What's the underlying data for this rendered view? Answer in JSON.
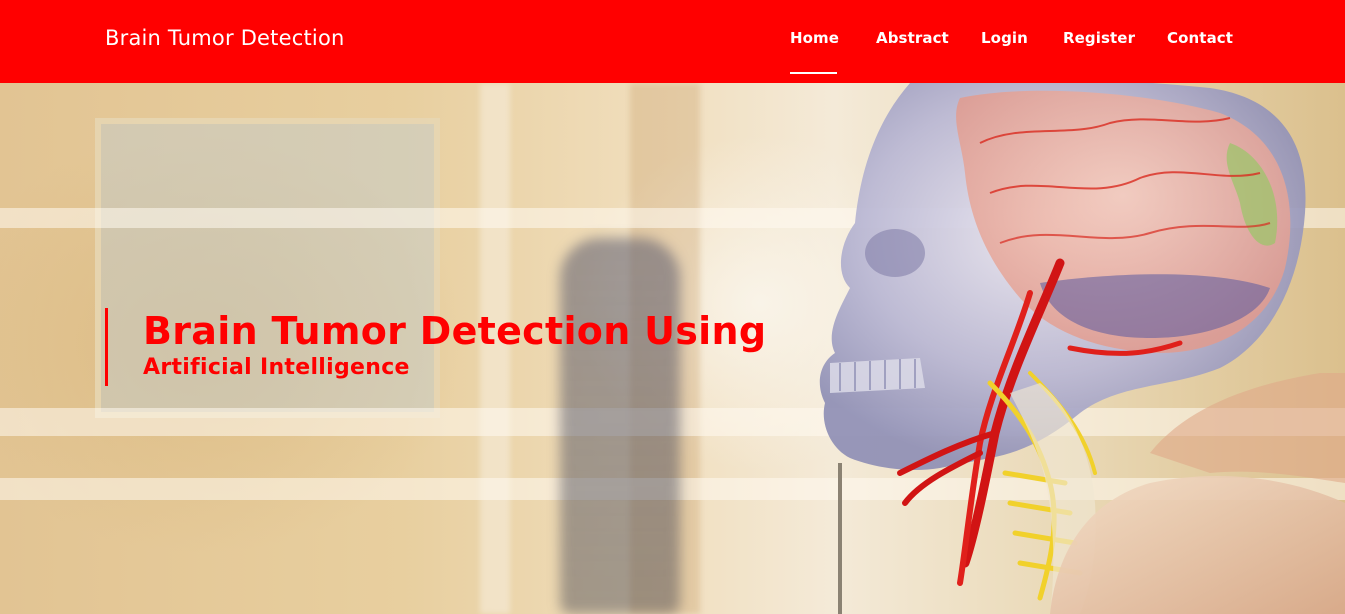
{
  "header": {
    "brand": "Brain Tumor Detection",
    "nav": [
      {
        "label": "Home",
        "active": true
      },
      {
        "label": "Abstract",
        "active": false
      },
      {
        "label": "Login",
        "active": false
      },
      {
        "label": "Register",
        "active": false
      },
      {
        "label": "Contact",
        "active": false
      }
    ]
  },
  "hero": {
    "title": "Brain Tumor Detection Using",
    "subtitle": "Artificial Intelligence",
    "image": "skull-brain-anatomical-model-photo"
  },
  "colors": {
    "accent": "#ff0000",
    "nav_text": "#ffffff"
  }
}
